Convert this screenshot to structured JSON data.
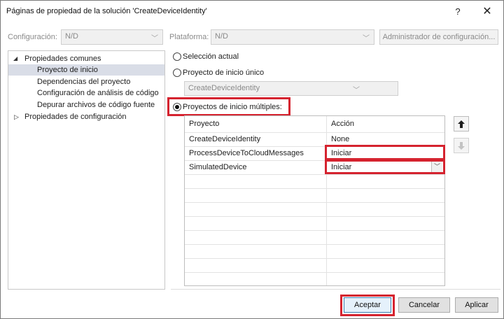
{
  "window": {
    "title": "Páginas de propiedad de la solución 'CreateDeviceIdentity'",
    "help_label": "?",
    "close_label": "✕"
  },
  "toolbar": {
    "config_label": "Configuración:",
    "config_value": "N/D",
    "platform_label": "Plataforma:",
    "platform_value": "N/D",
    "config_manager_label": "Administrador de configuración..."
  },
  "tree": {
    "items": [
      {
        "label": "Propiedades comunes",
        "expanded": true
      },
      {
        "label": "Proyecto de inicio",
        "selected": true
      },
      {
        "label": "Dependencias del proyecto"
      },
      {
        "label": "Configuración de análisis de código"
      },
      {
        "label": "Depurar archivos de código fuente"
      },
      {
        "label": "Propiedades de configuración",
        "expanded": false
      }
    ]
  },
  "startup": {
    "option_current": "Selección actual",
    "option_single": "Proyecto de inicio único",
    "single_value": "CreateDeviceIdentity",
    "option_multiple": "Proyectos de inicio múltiples:",
    "selected_option": "multiple"
  },
  "grid": {
    "headers": {
      "project": "Proyecto",
      "action": "Acción"
    },
    "rows": [
      {
        "project": "CreateDeviceIdentity",
        "action": "None"
      },
      {
        "project": "ProcessDeviceToCloudMessages",
        "action": "Iniciar"
      },
      {
        "project": "SimulatedDevice",
        "action": "Iniciar"
      }
    ]
  },
  "side_buttons": {
    "up_icon": "arrow-up-icon",
    "down_icon": "arrow-down-icon"
  },
  "footer": {
    "ok_label": "Aceptar",
    "cancel_label": "Cancelar",
    "apply_label": "Aplicar"
  },
  "colors": {
    "highlight_red": "#d5232f",
    "tree_selection": "#d9dde7",
    "primary_border": "#3c7fb1"
  }
}
